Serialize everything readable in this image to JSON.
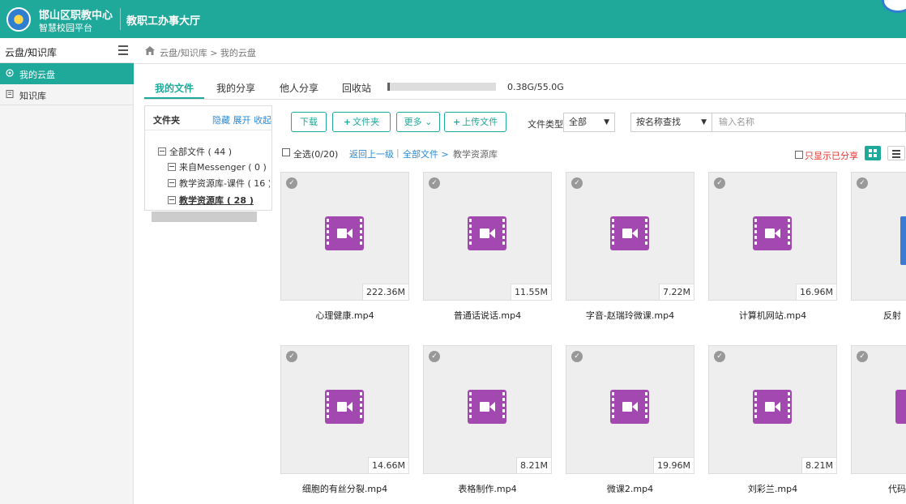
{
  "header": {
    "brand_name": "邯山区职教中心",
    "brand_sub": "智慧校园平台",
    "nav_title": "教职工办事大厅"
  },
  "sidebar": {
    "title": "云盘/知识库",
    "items": [
      {
        "label": "我的云盘",
        "active": true
      },
      {
        "label": "知识库",
        "active": false
      }
    ]
  },
  "breadcrumb": "云盘/知识库 > 我的云盘",
  "tabs": [
    "我的文件",
    "我的分享",
    "他人分享",
    "回收站"
  ],
  "quota": {
    "text": "0.38G/55.0G",
    "fraction": 0.007
  },
  "folder_panel": {
    "title": "文件夹",
    "actions": "隐藏 展开 收起",
    "tree": [
      {
        "label": "全部文件 ( 44 )"
      },
      {
        "label": "来自Messenger ( 0 )"
      },
      {
        "label": "教学资源库-课件 ( 16 )"
      },
      {
        "label": "教学资源库 ( 28 )"
      }
    ]
  },
  "toolbar": {
    "download": "下载",
    "new_folder": "文件夹",
    "more": "更多",
    "upload": "上传文件",
    "filetype_label": "文件类型",
    "filetype_value": "全部",
    "search_mode": "按名称查找",
    "search_placeholder": "输入名称"
  },
  "selection": {
    "select_all": "全选(0/20)",
    "back": "返回上一级",
    "path_root": "全部文件 >",
    "path_current": "教学资源库",
    "only_shared": "只显示已分享"
  },
  "files": [
    {
      "name": "心理健康.mp4",
      "size": "222.36M"
    },
    {
      "name": "普通话说话.mp4",
      "size": "11.55M"
    },
    {
      "name": "字音-赵瑞玲微课.mp4",
      "size": "7.22M"
    },
    {
      "name": "计算机网站.mp4",
      "size": "16.96M"
    },
    {
      "name": "反射",
      "size": ""
    },
    {
      "name": "细胞的有丝分裂.mp4",
      "size": "14.66M"
    },
    {
      "name": "表格制作.mp4",
      "size": "8.21M"
    },
    {
      "name": "微课2.mp4",
      "size": "19.96M"
    },
    {
      "name": "刘彩兰.mp4",
      "size": "8.21M"
    },
    {
      "name": "代码",
      "size": ""
    }
  ]
}
